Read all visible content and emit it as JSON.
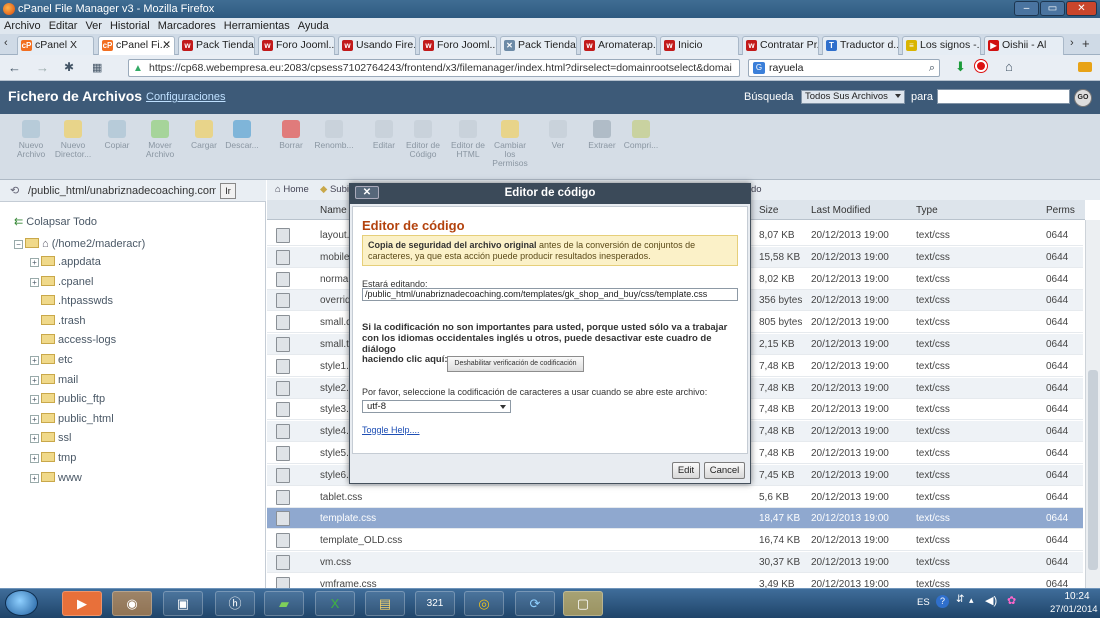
{
  "window": {
    "title": "cPanel File Manager v3 - Mozilla Firefox"
  },
  "menubar": [
    "Archivo",
    "Editar",
    "Ver",
    "Historial",
    "Marcadores",
    "Herramientas",
    "Ayuda"
  ],
  "tabs": [
    {
      "label": "cPanel X",
      "fav": "cP",
      "color": "#f26f21"
    },
    {
      "label": "cPanel Fi...",
      "fav": "cP",
      "color": "#f26f21",
      "active": true
    },
    {
      "label": "Pack Tienda...",
      "fav": "w",
      "color": "#c21a1a"
    },
    {
      "label": "Foro Jooml...",
      "fav": "w",
      "color": "#c21a1a"
    },
    {
      "label": "Usando Fire...",
      "fav": "w",
      "color": "#c21a1a"
    },
    {
      "label": "Foro Jooml...",
      "fav": "w",
      "color": "#c21a1a"
    },
    {
      "label": "Pack Tienda...",
      "fav": "✕",
      "color": "#6c8aa6"
    },
    {
      "label": "Aromaterap...",
      "fav": "w",
      "color": "#c21a1a"
    },
    {
      "label": "Inicio",
      "fav": "w",
      "color": "#c21a1a"
    },
    {
      "label": "Contratar Pr...",
      "fav": "w",
      "color": "#c21a1a"
    },
    {
      "label": "Traductor d...",
      "fav": "T",
      "color": "#2f6fcc"
    },
    {
      "label": "Los signos -...",
      "fav": "≡",
      "color": "#d9b400"
    },
    {
      "label": "Oishii - Al",
      "fav": "▶",
      "color": "#d01010"
    }
  ],
  "nav": {
    "url": "https://cp68.webempresa.eu:2083/cpsess7102764243/frontend/x3/filemanager/index.html?dirselect=domainrootselect&domai",
    "search": "rayuela"
  },
  "cpanel": {
    "title": "Fichero de Archivos",
    "config_link": "Configuraciones",
    "search_label": "Búsqueda",
    "search_scope": "Todos Sus Archivos",
    "search_for": "para",
    "go": "GO"
  },
  "toolbar": [
    {
      "label": "Nuevo Archivo",
      "icon": "new-file-icon",
      "color": "#b7cbd9"
    },
    {
      "label": "Nuevo Director...",
      "icon": "new-folder-icon",
      "color": "#e8d48a"
    },
    {
      "label": "Copiar",
      "icon": "copy-icon",
      "color": "#b7cbd9"
    },
    {
      "label": "Mover Archivo",
      "icon": "move-icon",
      "color": "#a6d49a"
    },
    {
      "label": "Cargar",
      "icon": "upload-icon",
      "color": "#e8d48a"
    },
    {
      "label": "Descar...",
      "icon": "download-icon",
      "color": "#7fb5d9"
    },
    {
      "label": "Borrar",
      "icon": "delete-icon",
      "color": "#e07b7b"
    },
    {
      "label": "Renomb...",
      "icon": "rename-icon",
      "color": "#c9d2db"
    },
    {
      "label": "Editar",
      "icon": "edit-icon",
      "color": "#c9d2db"
    },
    {
      "label": "Editor de Código",
      "icon": "code-editor-icon",
      "color": "#c9d2db"
    },
    {
      "label": "Editor de HTML",
      "icon": "html-editor-icon",
      "color": "#c9d2db"
    },
    {
      "label": "Cambiar los Permisos",
      "icon": "permissions-icon",
      "color": "#e8d48a"
    },
    {
      "label": "Ver",
      "icon": "view-icon",
      "color": "#c9d2db"
    },
    {
      "label": "Extraer",
      "icon": "extract-icon",
      "color": "#b0bcc7"
    },
    {
      "label": "Compri...",
      "icon": "compress-icon",
      "color": "#c9d2a0"
    }
  ],
  "leftpane": {
    "path": "/public_html/unabriznadecoaching.com/te",
    "go_btn": "Ir",
    "collapse": "Colapsar Todo",
    "root": "(/home2/maderacr)",
    "tree": [
      {
        "label": ".appdata",
        "plus": true
      },
      {
        "label": ".cpanel",
        "plus": true
      },
      {
        "label": ".htpasswds",
        "plus": false
      },
      {
        "label": ".trash",
        "plus": false
      },
      {
        "label": "access-logs",
        "plus": false
      },
      {
        "label": "etc",
        "plus": true
      },
      {
        "label": "mail",
        "plus": true
      },
      {
        "label": "public_ftp",
        "plus": true
      },
      {
        "label": "public_html",
        "plus": true
      },
      {
        "label": "ssl",
        "plus": true
      },
      {
        "label": "tmp",
        "plus": true
      },
      {
        "label": "www",
        "plus": true
      }
    ]
  },
  "rightpane": {
    "breadcrumb_home": "Home",
    "breadcrumb_up": "Subir un Nivel",
    "breadcrumb_tail": "do",
    "columns": [
      "Name",
      "Size",
      "Last Modified",
      "Type",
      "Perms"
    ],
    "rows": [
      {
        "name": "layout.css",
        "size": "8,07 KB",
        "mod": "20/12/2013 19:00",
        "type": "text/css",
        "perms": "0644"
      },
      {
        "name": "mobile.css",
        "size": "15,58 KB",
        "mod": "20/12/2013 19:00",
        "type": "text/css",
        "perms": "0644"
      },
      {
        "name": "normalize.css",
        "size": "8,02 KB",
        "mod": "20/12/2013 19:00",
        "type": "text/css",
        "perms": "0644"
      },
      {
        "name": "override.css",
        "size": "356 bytes",
        "mod": "20/12/2013 19:00",
        "type": "text/css",
        "perms": "0644"
      },
      {
        "name": "small.desktop.css",
        "size": "805 bytes",
        "mod": "20/12/2013 19:00",
        "type": "text/css",
        "perms": "0644"
      },
      {
        "name": "small.tablet.css",
        "size": "2,15 KB",
        "mod": "20/12/2013 19:00",
        "type": "text/css",
        "perms": "0644"
      },
      {
        "name": "style1.css",
        "size": "7,48 KB",
        "mod": "20/12/2013 19:00",
        "type": "text/css",
        "perms": "0644"
      },
      {
        "name": "style2.css",
        "size": "7,48 KB",
        "mod": "20/12/2013 19:00",
        "type": "text/css",
        "perms": "0644"
      },
      {
        "name": "style3.css",
        "size": "7,48 KB",
        "mod": "20/12/2013 19:00",
        "type": "text/css",
        "perms": "0644"
      },
      {
        "name": "style4.css",
        "size": "7,48 KB",
        "mod": "20/12/2013 19:00",
        "type": "text/css",
        "perms": "0644"
      },
      {
        "name": "style5.css",
        "size": "7,48 KB",
        "mod": "20/12/2013 19:00",
        "type": "text/css",
        "perms": "0644"
      },
      {
        "name": "style6.css",
        "size": "7,45 KB",
        "mod": "20/12/2013 19:00",
        "type": "text/css",
        "perms": "0644"
      },
      {
        "name": "tablet.css",
        "size": "5,6 KB",
        "mod": "20/12/2013 19:00",
        "type": "text/css",
        "perms": "0644"
      },
      {
        "name": "template.css",
        "size": "18,47 KB",
        "mod": "20/12/2013 19:00",
        "type": "text/css",
        "perms": "0644",
        "selected": true
      },
      {
        "name": "template_OLD.css",
        "size": "16,74 KB",
        "mod": "20/12/2013 19:00",
        "type": "text/css",
        "perms": "0644"
      },
      {
        "name": "vm.css",
        "size": "30,37 KB",
        "mod": "20/12/2013 19:00",
        "type": "text/css",
        "perms": "0644"
      },
      {
        "name": "vmframe.css",
        "size": "3,49 KB",
        "mod": "20/12/2013 19:00",
        "type": "text/css",
        "perms": "0644"
      }
    ]
  },
  "dialog": {
    "titlebar": "Editor de código",
    "close": "✕",
    "heading": "Editor de código",
    "warning_bold": "Copia de seguridad del archivo original",
    "warning_rest": " antes de la conversión de conjuntos de caracteres, ya que esta acción puede producir resultados inesperados.",
    "editing_label": "Estará editando:",
    "editing_path": "/public_html/unabriznadecoaching.com/templates/gk_shop_and_buy/css/template.css",
    "encoding_note": "Si la codificación no son importantes para usted, porque usted sólo va a trabajar con los idiomas occidentales inglés u otros, puede desactivar este cuadro de diálogo",
    "click_label": "haciendo clic aquí:",
    "disable_btn": "Deshabilitar verificación de codificación",
    "select_label": "Por favor, seleccione la codificación de caracteres a usar cuando se abre este archivo:",
    "encoding": "utf-8",
    "toggle_help": "Toggle Help....",
    "edit_btn": "Edit",
    "cancel_btn": "Cancel"
  },
  "taskbar": {
    "lang": "ES",
    "time": "10:24",
    "date": "27/01/2014"
  }
}
